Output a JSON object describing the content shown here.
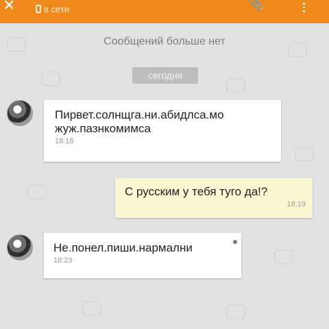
{
  "header": {
    "status": "в сети",
    "accent": "#f08a1c"
  },
  "chat": {
    "no_more_messages": "Сообщений больше нет",
    "date_divider": "сегодня",
    "messages": [
      {
        "direction": "in",
        "text": "Пирвет.солнщга.ни.абидлса.мо жуж.пазнкомимса",
        "time": "18:18"
      },
      {
        "direction": "out",
        "text": "С русским у тебя туго да!?",
        "time": "18:19"
      },
      {
        "direction": "in",
        "text": "Не.понел.пиши.нармални",
        "time": "18:23"
      }
    ]
  },
  "colors": {
    "incoming_bubble": "#ffffff",
    "outgoing_bubble": "#fbf7d2",
    "background": "#e2e2e2"
  }
}
